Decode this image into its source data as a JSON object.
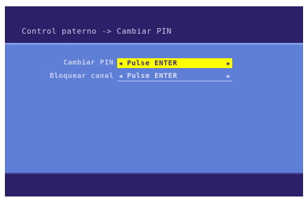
{
  "header": {
    "title": "Control paterno -> Cambiar PIN"
  },
  "menu": {
    "items": [
      {
        "label": "Cambiar PIN",
        "value": "Pulse ENTER",
        "left_icon": "triangle-left-icon",
        "right_icon": "triangle-right-icon",
        "selected": true
      },
      {
        "label": "Bloquear canal",
        "value": "Pulse ENTER",
        "left_icon": "triangle-left-icon",
        "right_icon": "triangle-right-icon",
        "selected": false
      }
    ]
  },
  "colors": {
    "frame": "#2d1f68",
    "panel": "#5f7ed6",
    "highlight": "#ffff00",
    "highlight_text": "#3a2a7a",
    "title_text": "#c9c7ee"
  }
}
